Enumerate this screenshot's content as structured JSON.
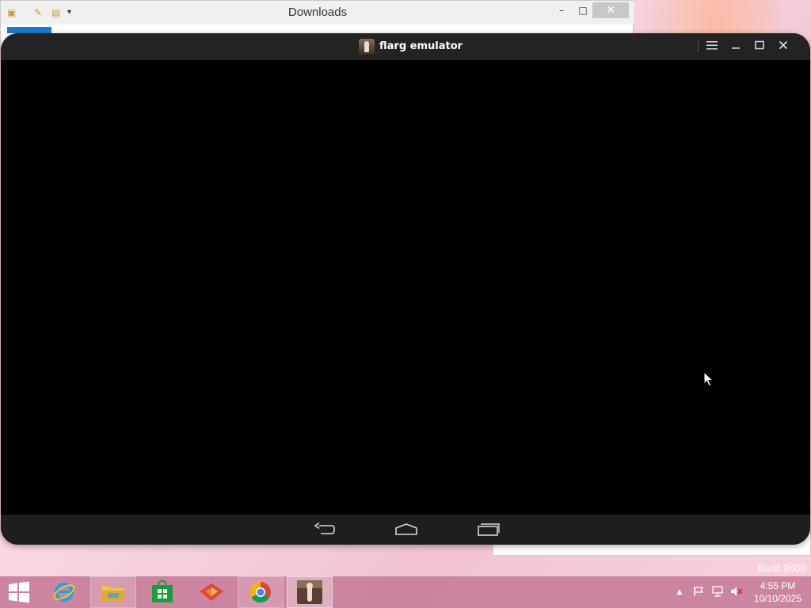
{
  "explorer": {
    "title": "Downloads",
    "minimize_glyph": "–",
    "maximize_glyph": "□",
    "close_glyph": "✕"
  },
  "emulator": {
    "title": "flarg emulator",
    "menu_icon": "hamburger-menu-icon",
    "minimize_icon": "minimize-icon",
    "maximize_icon": "maximize-icon",
    "close_icon": "close-icon",
    "nav": [
      "back-icon",
      "home-icon",
      "recent-apps-icon"
    ]
  },
  "desktop": {
    "build_text": "Build 9600"
  },
  "taskbar": {
    "start_icon": "windows-start-icon",
    "apps": [
      "internet-explorer-icon",
      "file-explorer-icon",
      "windows-store-icon",
      "foxy-app-icon",
      "chrome-icon",
      "flarg-emulator-icon"
    ],
    "tray": [
      "show-hidden-icons-arrow",
      "action-center-flag-icon",
      "network-icon",
      "volume-muted-icon"
    ],
    "time": "4:55 PM",
    "date": "10/10/2025"
  },
  "colors": {
    "emulator_titlebar": "#232323",
    "emulator_navbar": "#1e1e1e",
    "taskbar": "#c47896",
    "explorer_ribbon": "#1979ca"
  }
}
